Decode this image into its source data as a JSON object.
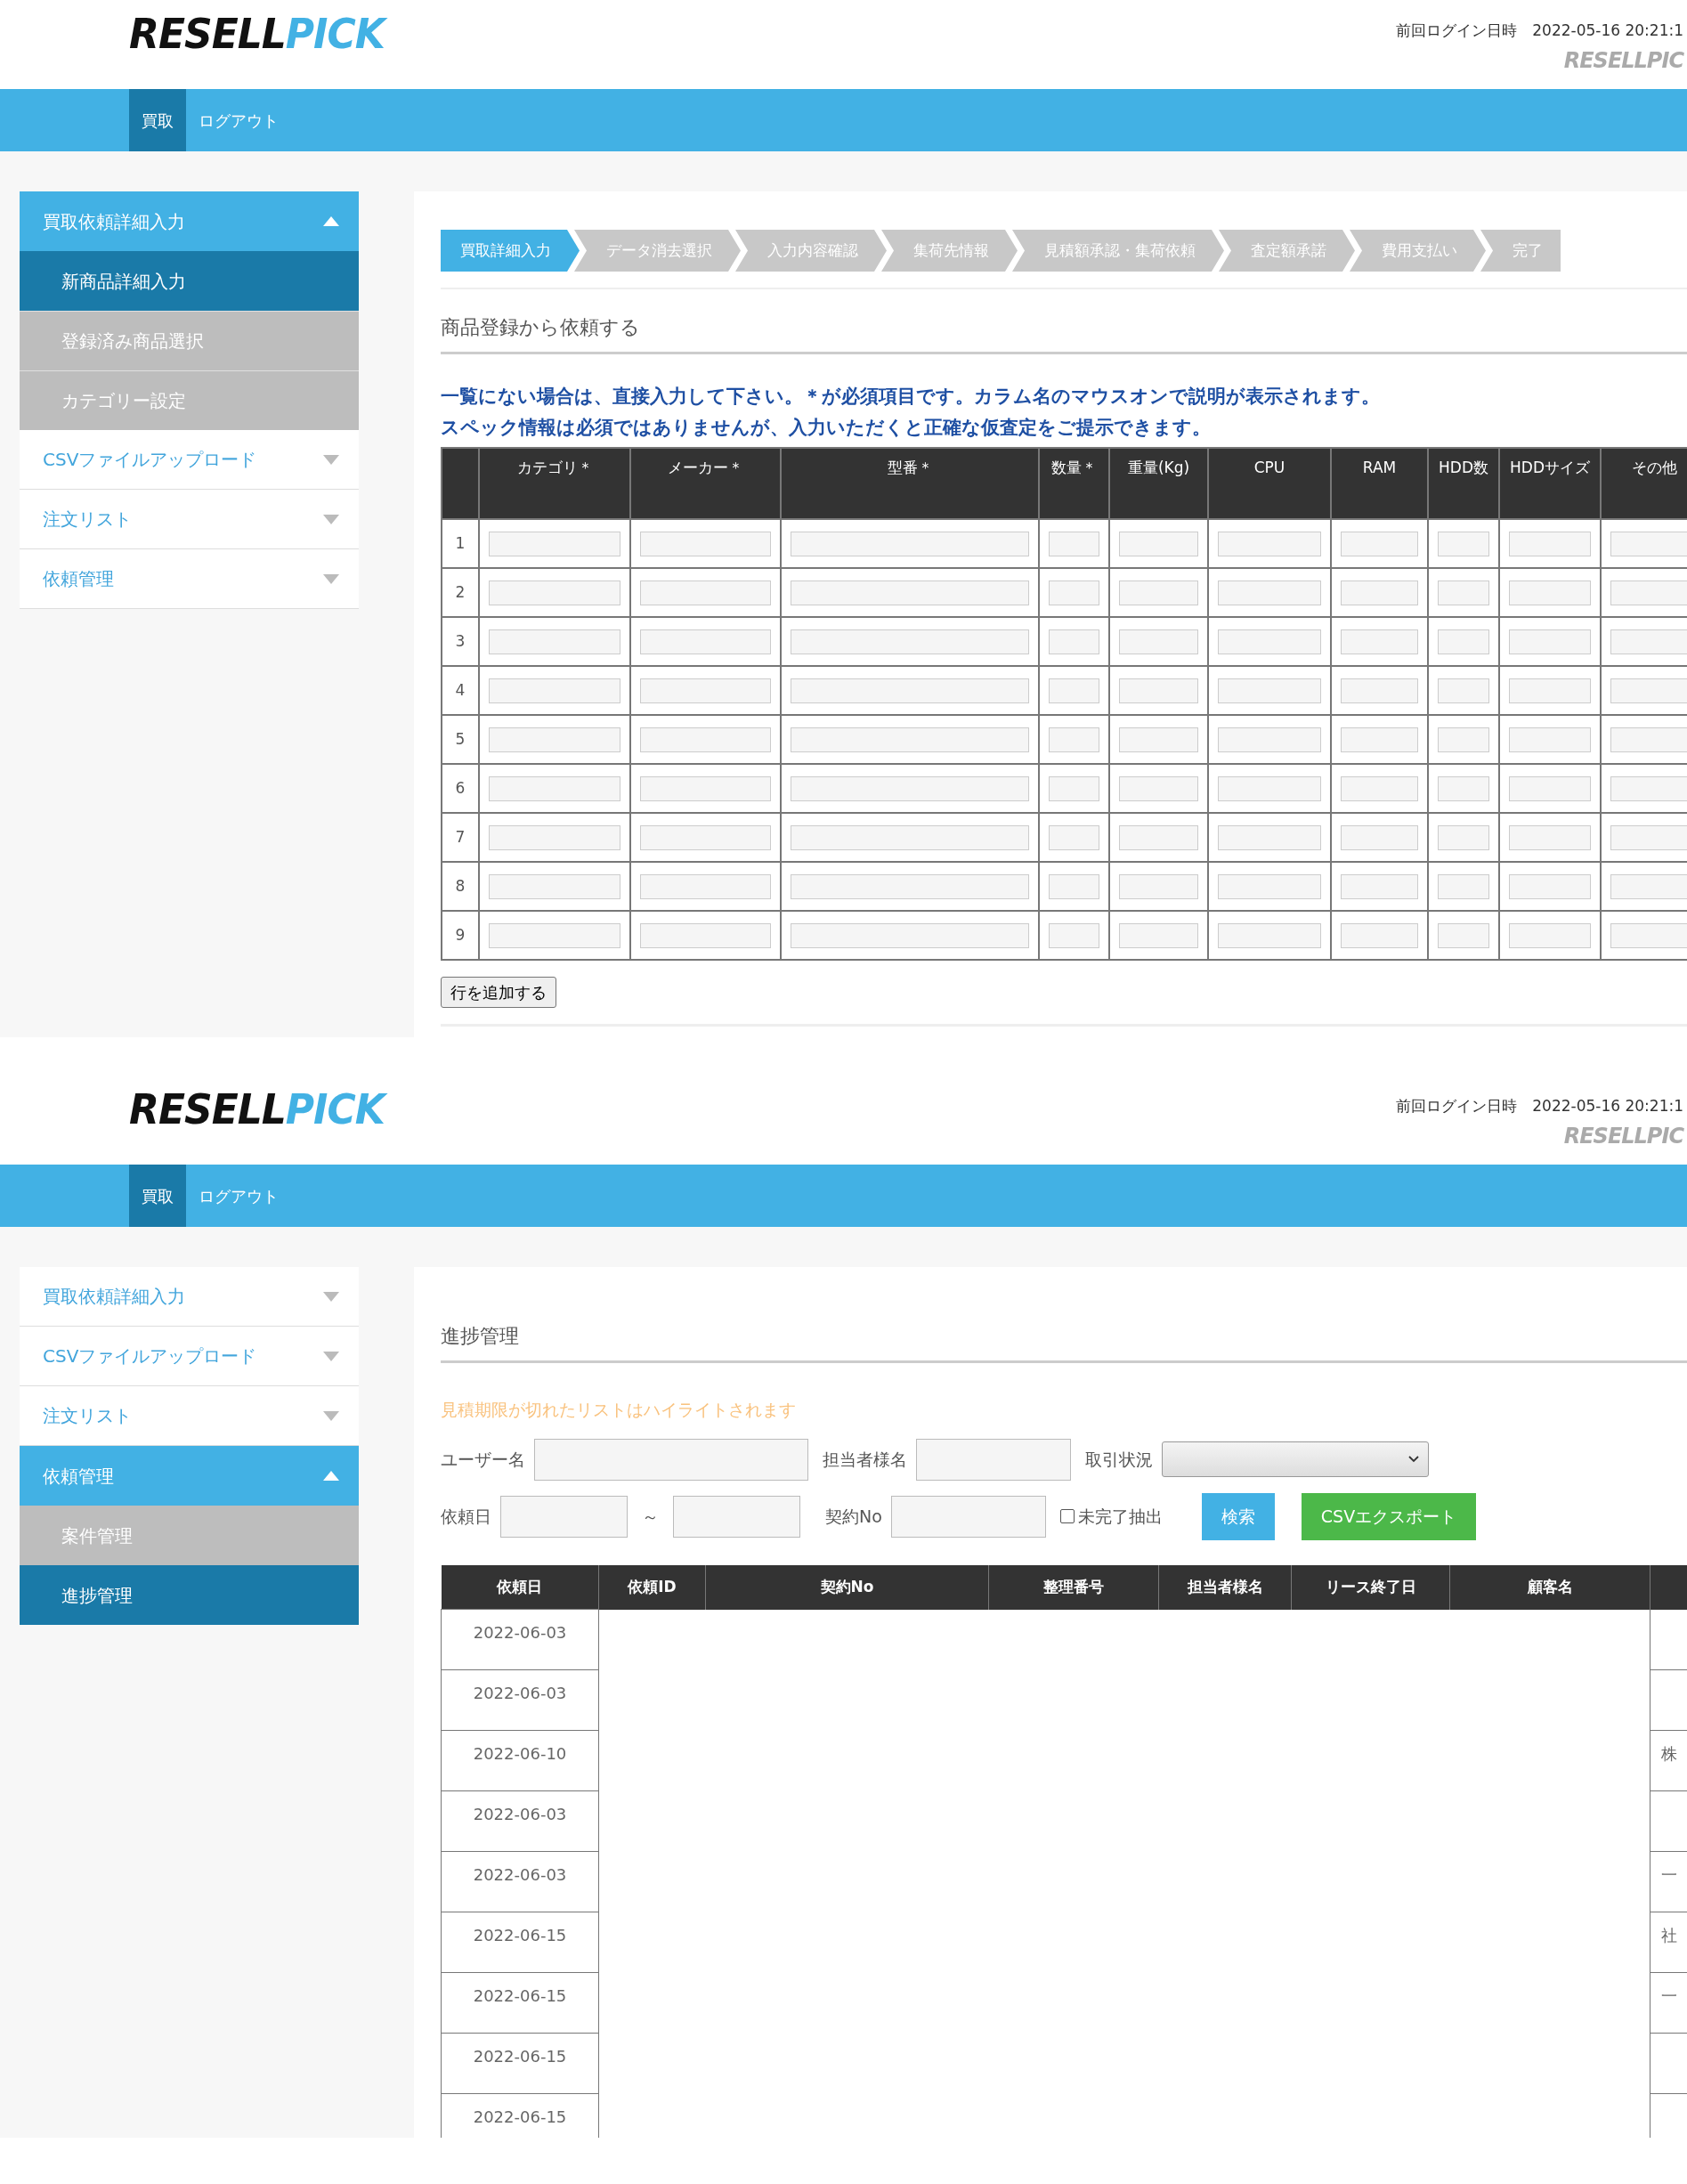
{
  "screens": [
    {
      "kind": "entry",
      "header": {
        "logo": {
          "dark": "RESELL",
          "accent": "PICK"
        },
        "last_login_label": "前回ログイン日時",
        "last_login_value": "2022-05-16 20:21:1",
        "small_logo": "RESELLPIC"
      },
      "nav": [
        {
          "label": "買取",
          "selected": true
        },
        {
          "label": "ログアウト",
          "selected": false
        }
      ],
      "sidebar": [
        {
          "label": "買取依頼詳細入力",
          "expanded": true,
          "children": [
            {
              "label": "新商品詳細入力",
              "selected": true
            },
            {
              "label": "登録済み商品選択",
              "selected": false
            },
            {
              "label": "カテゴリー設定",
              "selected": false
            }
          ]
        },
        {
          "label": "CSVファイルアップロード",
          "expanded": false
        },
        {
          "label": "注文リスト",
          "expanded": false
        },
        {
          "label": "依頼管理",
          "expanded": false
        }
      ],
      "steps": [
        {
          "label": "買取詳細入力",
          "selected": true
        },
        {
          "label": "データ消去選択",
          "selected": false
        },
        {
          "label": "入力内容確認",
          "selected": false
        },
        {
          "label": "集荷先情報",
          "selected": false
        },
        {
          "label": "見積額承認・集荷依頼",
          "selected": false
        },
        {
          "label": "査定額承諾",
          "selected": false
        },
        {
          "label": "費用支払い",
          "selected": false
        },
        {
          "label": "完了",
          "selected": false
        }
      ],
      "heading": "商品登録から依頼する",
      "notices": [
        "一覧にない場合は、直接入力して下さい。＊が必須項目です。カラム名のマウスオンで説明が表示されます。",
        "スペック情報は必須ではありませんが、入力いただくと正確な仮査定をご提示できます。"
      ],
      "table": {
        "columns": [
          "カテゴリ＊",
          "メーカー＊",
          "型番＊",
          "数量＊",
          "重量(Kg)",
          "CPU",
          "RAM",
          "HDD数",
          "HDDサイズ",
          "その他"
        ],
        "rows": [
          "1",
          "2",
          "3",
          "4",
          "5",
          "6",
          "7",
          "8",
          "9"
        ]
      },
      "add_row_button": "行を追加する"
    },
    {
      "kind": "progress",
      "header": {
        "logo": {
          "dark": "RESELL",
          "accent": "PICK"
        },
        "last_login_label": "前回ログイン日時",
        "last_login_value": "2022-05-16 20:21:1",
        "small_logo": "RESELLPIC"
      },
      "nav": [
        {
          "label": "買取",
          "selected": true
        },
        {
          "label": "ログアウト",
          "selected": false
        }
      ],
      "sidebar": [
        {
          "label": "買取依頼詳細入力",
          "expanded": false
        },
        {
          "label": "CSVファイルアップロード",
          "expanded": false
        },
        {
          "label": "注文リスト",
          "expanded": false
        },
        {
          "label": "依頼管理",
          "expanded": true,
          "children": [
            {
              "label": "案件管理",
              "selected": false
            },
            {
              "label": "進捗管理",
              "selected": true
            }
          ]
        }
      ],
      "heading": "進捗管理",
      "notice": "見積期限が切れたリストはハイライトされます",
      "filter_rows": [
        [
          {
            "kind": "text",
            "label": "ユーザー名"
          },
          {
            "kind": "text",
            "label": "担当者様名"
          },
          {
            "kind": "select",
            "label": "取引状況"
          }
        ],
        [
          {
            "kind": "range",
            "label": "依頼日",
            "separator": "～"
          },
          {
            "kind": "text",
            "label": "契約No"
          },
          {
            "kind": "checkbox",
            "label": "未完了抽出",
            "checked": false
          },
          {
            "kind": "button",
            "label": "検索",
            "color": "#42b1e4"
          },
          {
            "kind": "button",
            "label": "CSVエクスポート",
            "color": "#4cb849"
          }
        ]
      ],
      "table": {
        "columns": [
          "依頼日",
          "依頼ID",
          "契約No",
          "整理番号",
          "担当者様名",
          "リース終了日",
          "顧客名"
        ],
        "rows": [
          {
            "date": "2022-06-03"
          },
          {
            "date": "2022-06-03"
          },
          {
            "date": "2022-06-10",
            "column_8": "株"
          },
          {
            "date": "2022-06-03"
          },
          {
            "date": "2022-06-03",
            "column_8": "一"
          },
          {
            "date": "2022-06-15",
            "column_8": "社"
          },
          {
            "date": "2022-06-15",
            "column_8": "一"
          },
          {
            "date": "2022-06-15"
          },
          {
            "date": "2022-06-15"
          }
        ]
      }
    }
  ]
}
